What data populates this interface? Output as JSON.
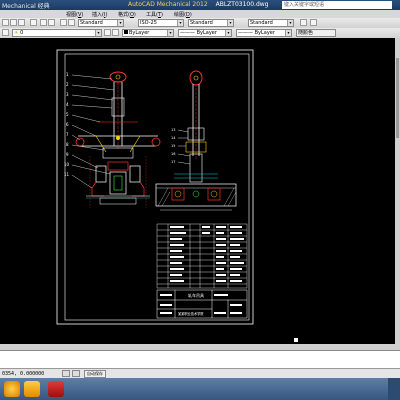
{
  "titlebar": {
    "app_title": "Mechanical 经典",
    "doc_title": "AutoCAD Mechanical 2012",
    "doc_file": "ABLZT03100.dwg",
    "help_search": "键入关键字或短语"
  },
  "menus": [
    {
      "pre": "",
      "u": "",
      "post": ""
    },
    {
      "pre": "视图(",
      "u": "V",
      "post": ")"
    },
    {
      "pre": "插入(",
      "u": "I",
      "post": ")"
    },
    {
      "pre": "格式(",
      "u": "O",
      "post": ")"
    },
    {
      "pre": "工具(",
      "u": "T",
      "post": ")"
    },
    {
      "pre": "绘图(",
      "u": "D",
      "post": ")"
    }
  ],
  "toolbar": {
    "text_style": "Standard",
    "dim_style": "ISO-25",
    "table_style": "Standard",
    "mleader_style": "Standard",
    "layer": "0",
    "color": "ByLayer",
    "linetype": "ByLayer",
    "lineweight": "ByLayer",
    "plot_style": "随颜色"
  },
  "commandline": {
    "text": ""
  },
  "statusbar": {
    "coords": "0354, 0.000000"
  },
  "tray": {
    "label": "自动保存"
  },
  "drawing": {
    "title_block": {
      "name": "轧车吊具",
      "org": "某某职业技术学院"
    },
    "part_numbers": [
      "1",
      "2",
      "3",
      "4",
      "5",
      "6",
      "7",
      "8",
      "9",
      "10",
      "11"
    ],
    "right_numbers": [
      "13",
      "14",
      "15",
      "16",
      "17"
    ]
  },
  "colors": {
    "background": "#000000",
    "border": "#ffffff",
    "part": "#ff3030",
    "geometry": "#ffffff",
    "hidden": "#00cfcf",
    "accent": "#ffd200",
    "green": "#30ff30"
  }
}
